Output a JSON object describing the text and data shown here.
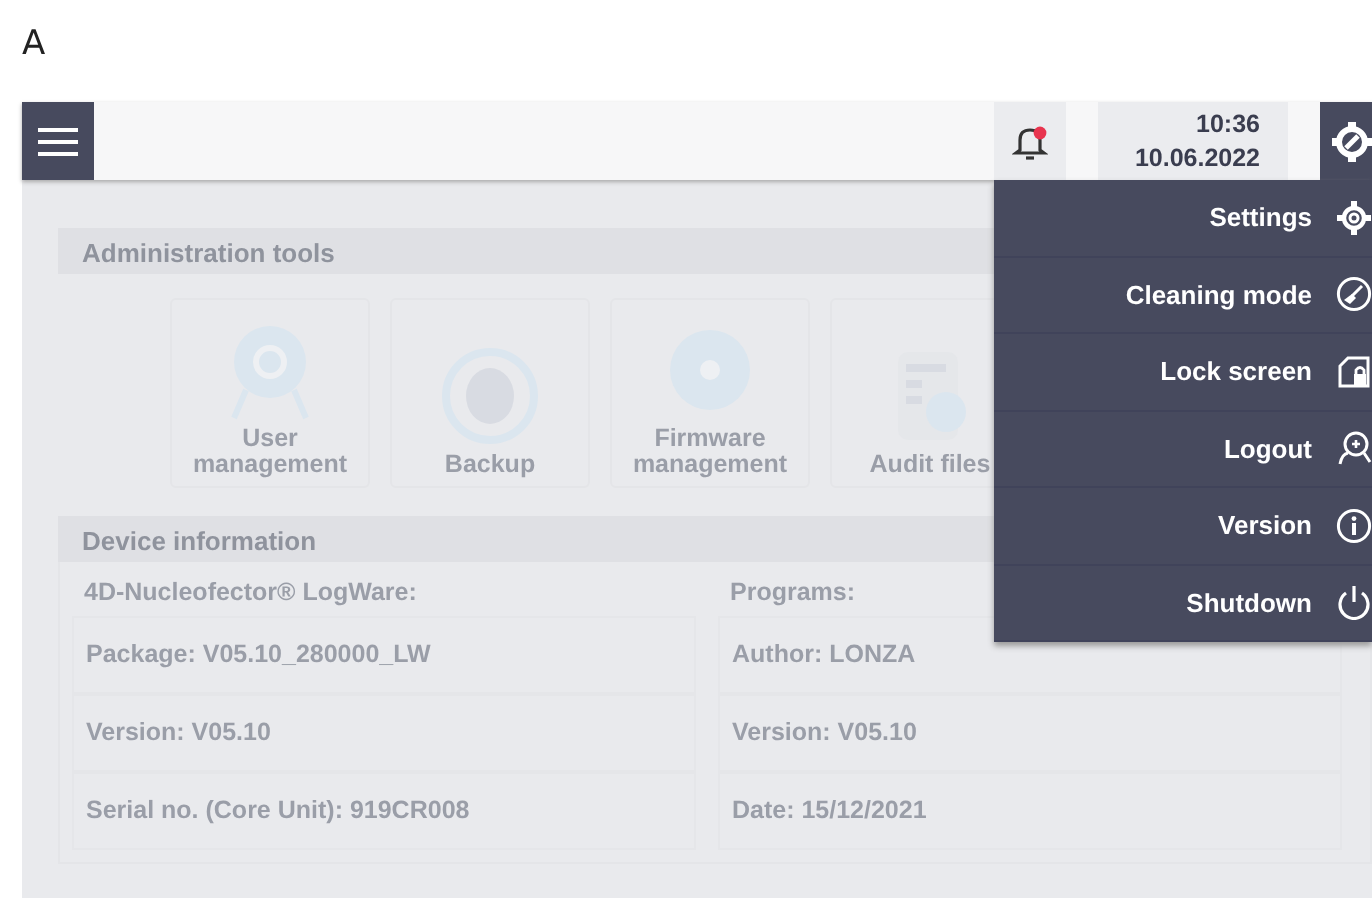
{
  "figure_label": "A",
  "header": {
    "notification": {
      "unread": true
    },
    "time": "10:36",
    "date": "10.06.2022"
  },
  "admin_tools": {
    "title": "Administration tools",
    "tiles": [
      {
        "label": "User management",
        "kind": "user"
      },
      {
        "label": "Backup",
        "kind": "backup"
      },
      {
        "label": "Firmware management",
        "kind": "firmware"
      },
      {
        "label": "Audit files",
        "kind": "audit"
      }
    ]
  },
  "device_info": {
    "title": "Device information",
    "columns": [
      {
        "heading": "4D-Nucleofector® LogWare:",
        "rows": [
          "Package: V05.10_280000_LW",
          "Version: V05.10",
          "Serial no. (Core Unit): 919CR008"
        ]
      },
      {
        "heading": "Programs:",
        "rows": [
          "Author: LONZA",
          "Version: V05.10",
          "Date: 15/12/2021"
        ]
      }
    ]
  },
  "settings_menu": {
    "open": true,
    "items": [
      {
        "label": "Settings",
        "kind": "settings"
      },
      {
        "label": "Cleaning mode",
        "kind": "cleaning"
      },
      {
        "label": "Lock screen",
        "kind": "lock"
      },
      {
        "label": "Logout",
        "kind": "logout"
      },
      {
        "label": "Version",
        "kind": "info"
      },
      {
        "label": "Shutdown",
        "kind": "power"
      }
    ]
  }
}
